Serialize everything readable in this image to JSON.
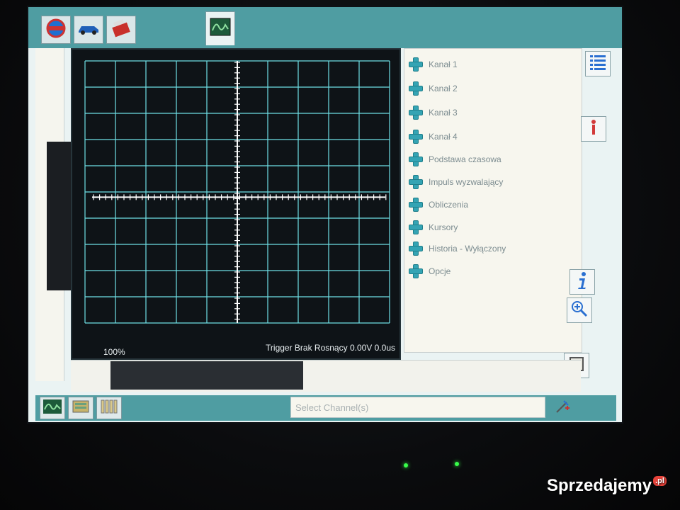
{
  "colors": {
    "accent": "#4f9da2",
    "scope_bg": "#0e1317",
    "grid": "#6fe0e6",
    "panel_bg": "#f7f6ee",
    "menu_text": "#7c8c90",
    "plus_icon": "#34a4b4"
  },
  "tabs": [
    {
      "icon": "nissan-logo-icon"
    },
    {
      "icon": "car-icon"
    },
    {
      "icon": "toolbox-icon"
    },
    {
      "icon": "oscilloscope-wave-icon",
      "active": true
    }
  ],
  "scope": {
    "zoom_label": "100%",
    "trigger_label": "Trigger Brak Rosnący 0.00V 0.0us"
  },
  "menu": {
    "items": [
      {
        "label": "Kanał 1"
      },
      {
        "label": "Kanał 2"
      },
      {
        "label": "Kanał 3"
      },
      {
        "label": "Kanał 4"
      },
      {
        "label": "Podstawa czasowa"
      },
      {
        "label": "Impuls wyzwalający"
      },
      {
        "label": "Obliczenia"
      },
      {
        "label": "Kursory"
      },
      {
        "label": "Historia - Wyłączony"
      },
      {
        "label": "Opcje"
      }
    ]
  },
  "right_toolbar": [
    {
      "icon": "list-icon"
    },
    {
      "icon": "person-icon"
    },
    {
      "icon": "info-icon"
    },
    {
      "icon": "zoom-icon"
    },
    {
      "icon": "frame-icon"
    }
  ],
  "taskbar": {
    "buttons": [
      {
        "icon": "oscilloscope-wave-icon"
      },
      {
        "icon": "module-icon"
      },
      {
        "icon": "battery-pack-icon"
      }
    ],
    "select_placeholder": "Select Channel(s)",
    "clear_icon": "wand-icon"
  },
  "watermark": {
    "brand": "Sprzedajemy",
    "tld": ".pl"
  }
}
